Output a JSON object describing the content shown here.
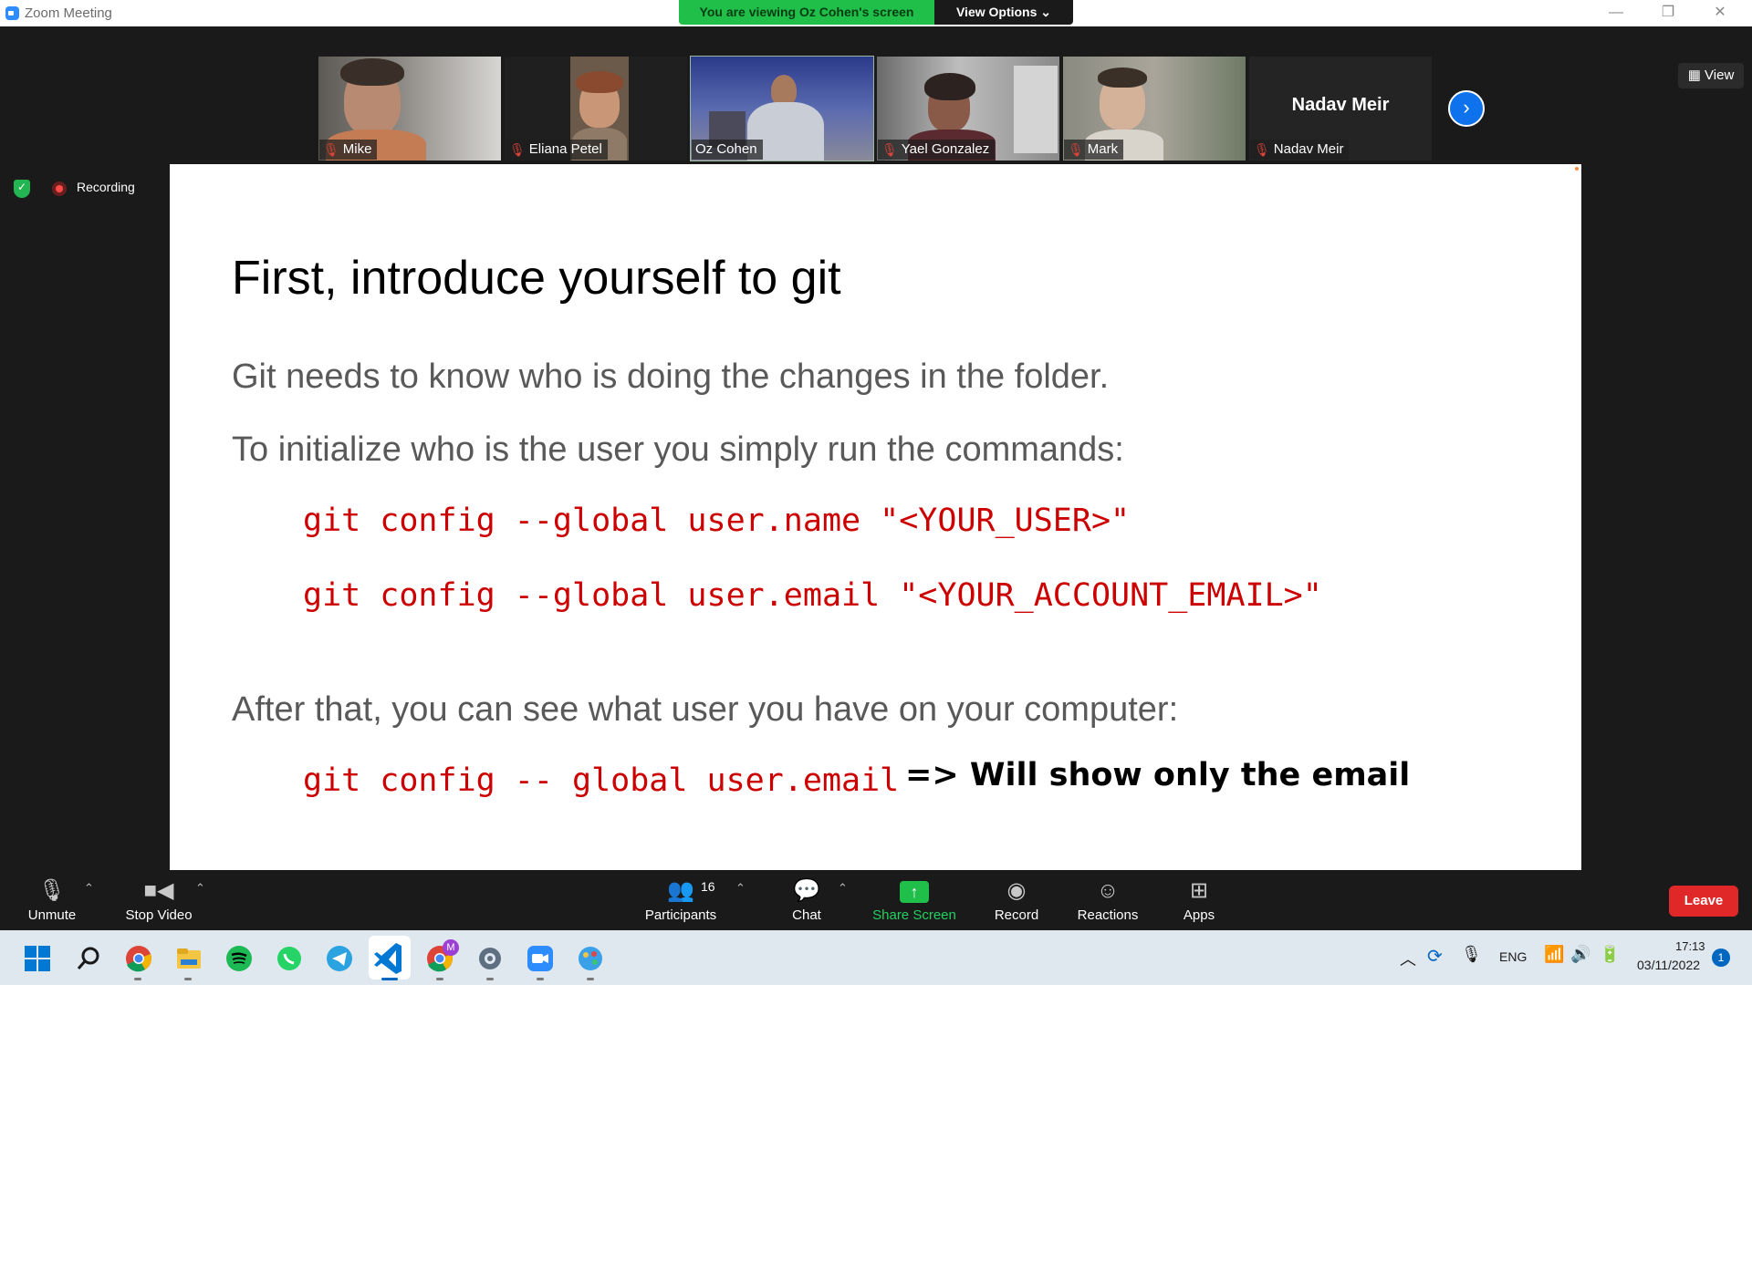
{
  "window": {
    "title": "Zoom Meeting",
    "minimize_glyph": "—",
    "maximize_glyph": "❐",
    "close_glyph": "✕"
  },
  "banner": {
    "viewing_text": "You are viewing Oz Cohen's screen",
    "view_options_label": "View Options ⌄"
  },
  "participants_strip": [
    {
      "name": "Mike",
      "muted": true
    },
    {
      "name": "Eliana Petel",
      "muted": true
    },
    {
      "name": "Oz Cohen",
      "muted": false,
      "active": true
    },
    {
      "name": "Yael Gonzalez",
      "muted": true
    },
    {
      "name": "Mark",
      "muted": true
    },
    {
      "name": "Nadav Meir",
      "muted": true,
      "video_off": true,
      "display_name": "Nadav Meir"
    }
  ],
  "view_button": "▦ View",
  "next_page_glyph": "›",
  "recording": {
    "label": "Recording"
  },
  "slide": {
    "title": "First, introduce yourself to git",
    "line1": "Git needs to know who is doing the changes in the folder.",
    "line2": "To initialize who is the user you simply run the commands:",
    "code1": "git config --global user.name \"<YOUR_USER>\"",
    "code2": "git config --global user.email \"<YOUR_ACCOUNT_EMAIL>\"",
    "line3": "After that, you can see what user you have on your computer:",
    "code3": "git config -- global user.email",
    "note": "=> Will show only the email"
  },
  "toolbar": {
    "unmute": "Unmute",
    "stop_video": "Stop Video",
    "participants": "Participants",
    "participants_count": "16",
    "chat": "Chat",
    "share_screen": "Share Screen",
    "record": "Record",
    "reactions": "Reactions",
    "apps": "Apps",
    "leave": "Leave",
    "caret": "⌃"
  },
  "taskbar": {
    "language": "ENG",
    "time": "17:13",
    "date": "03/11/2022",
    "notifications": "1",
    "chrome_profile_badge": "M"
  },
  "colors": {
    "banner_green": "#1fbf4a",
    "code_red": "#cc0000",
    "leave_red": "#e02828",
    "accent_blue": "#0e72ed"
  }
}
